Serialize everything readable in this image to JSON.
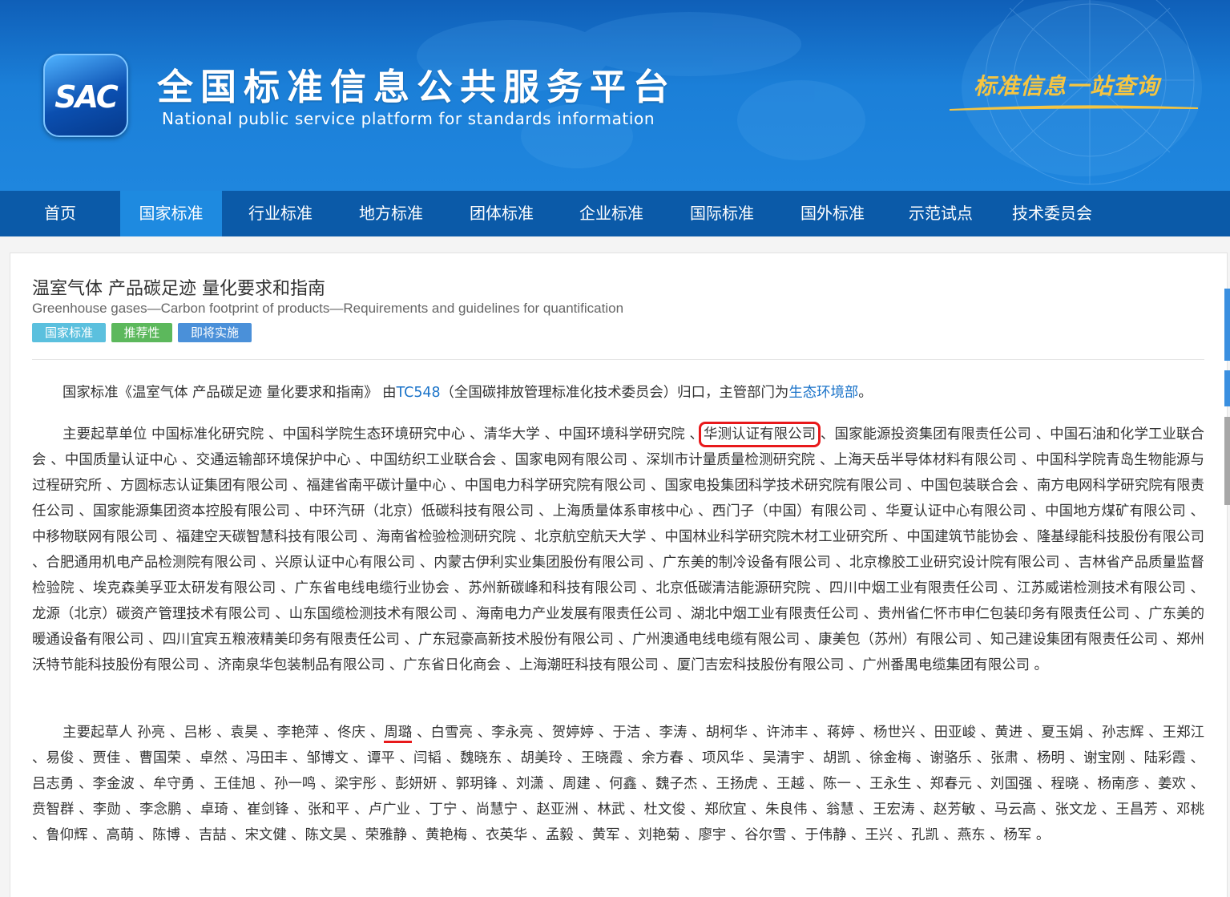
{
  "header": {
    "logo_text": "SAC",
    "title": "全国标准信息公共服务平台",
    "subtitle": "National public service platform  for standards information",
    "slogan": "标准信息一站查询"
  },
  "nav": {
    "items": [
      "首页",
      "国家标准",
      "行业标准",
      "地方标准",
      "团体标准",
      "企业标准",
      "国际标准",
      "国外标准",
      "示范试点",
      "技术委员会"
    ],
    "active_index": 1
  },
  "standard": {
    "title_cn": "温室气体 产品碳足迹 量化要求和指南",
    "title_en": "Greenhouse gases—Carbon footprint of products—Requirements and guidelines for quantification",
    "tags": [
      {
        "label": "国家标准",
        "color": "#5bc0de"
      },
      {
        "label": "推荐性",
        "color": "#5cb85c"
      },
      {
        "label": "即将实施",
        "color": "#4a90d9"
      }
    ]
  },
  "intro": {
    "prefix": "国家标准《温室气体 产品碳足迹 量化要求和指南》 由",
    "tc_link": "TC548",
    "middle": "（全国碳排放管理标准化技术委员会）归口，主管部门为",
    "dept_link": "生态环境部",
    "suffix": "。"
  },
  "drafting_units": {
    "label": "主要起草单位",
    "before": " 中国标准化研究院 、中国科学院生态环境研究中心 、清华大学 、中国环境科学研究院 、",
    "highlighted": "华测认证有限公司",
    "after": " 、国家能源投资集团有限责任公司 、中国石油和化学工业联合会 、中国质量认证中心 、交通运输部环境保护中心 、中国纺织工业联合会 、国家电网有限公司 、深圳市计量质量检测研究院 、上海天岳半导体材料有限公司 、中国科学院青岛生物能源与过程研究所 、方圆标志认证集团有限公司 、福建省南平碳计量中心 、中国电力科学研究院有限公司 、国家电投集团科学技术研究院有限公司 、中国包装联合会 、南方电网科学研究院有限责任公司 、国家能源集团资本控股有限公司 、中环汽研（北京）低碳科技有限公司 、上海质量体系审核中心 、西门子（中国）有限公司 、华夏认证中心有限公司 、中国地方煤矿有限公司 、中移物联网有限公司 、福建空天碳智慧科技有限公司 、海南省检验检测研究院 、北京航空航天大学 、中国林业科学研究院木材工业研究所 、中国建筑节能协会 、隆基绿能科技股份有限公司 、合肥通用机电产品检测院有限公司 、兴原认证中心有限公司 、内蒙古伊利实业集团股份有限公司 、广东美的制冷设备有限公司 、北京橡胶工业研究设计院有限公司 、吉林省产品质量监督检验院 、埃克森美孚亚太研发有限公司 、广东省电线电缆行业协会 、苏州新碳峰和科技有限公司 、北京低碳清洁能源研究院 、四川中烟工业有限责任公司 、江苏威诺检测技术有限公司 、龙源（北京）碳资产管理技术有限公司 、山东国缆检测技术有限公司 、海南电力产业发展有限责任公司 、湖北中烟工业有限责任公司 、贵州省仁怀市申仁包装印务有限责任公司 、广东美的暖通设备有限公司 、四川宜宾五粮液精美印务有限责任公司 、广东冠豪高新技术股份有限公司 、广州澳通电线电缆有限公司 、康美包（苏州）有限公司 、知己建设集团有限责任公司 、郑州沃特节能科技股份有限公司 、济南泉华包装制品有限公司 、广东省日化商会 、上海潮旺科技有限公司 、厦门吉宏科技股份有限公司 、广州番禺电缆集团有限公司 。"
  },
  "drafters": {
    "label": "主要起草人",
    "before": " 孙亮 、吕彬 、袁昊 、李艳萍 、佟庆 、",
    "highlighted": "周璐",
    "after": " 、白雪亮 、李永亮 、贺婷婷 、于洁 、李涛 、胡柯华 、许沛丰 、蒋婷 、杨世兴 、田亚峻 、黄进 、夏玉娟 、孙志辉 、王郑江 、易俊 、贾佳 、曹国荣 、卓然 、冯田丰 、邹博文 、谭平 、闫韬 、魏晓东 、胡美玲 、王晓霞 、余方春 、项风华 、吴清宇 、胡凯 、徐金梅 、谢骆乐 、张肃 、杨明 、谢宝刚 、陆彩霞 、吕志勇 、李金波 、牟守勇 、王佳旭 、孙一鸣 、梁宇彤 、彭妍妍 、郭玥锋 、刘潇 、周建 、何鑫 、魏子杰 、王扬虎 、王越 、陈一 、王永生 、郑春元 、刘国强 、程晓 、杨南彦 、姜欢 、贲智群 、李勋 、李念鹏 、卓琦 、崔剑锋 、张和平 、卢广业 、丁宁 、尚慧宁 、赵亚洲 、林武 、杜文俊 、郑欣宜 、朱良伟 、翁慧 、王宏涛 、赵芳敏 、马云高 、张文龙 、王昌芳 、邓桃 、鲁仰辉 、高萌 、陈博 、吉喆 、宋文健 、陈文昊 、荣雅静 、黄艳梅 、衣英华 、孟毅 、黄军 、刘艳菊 、廖宇 、谷尔雪 、于伟静 、王兴 、孔凯 、燕东 、杨军 。"
  }
}
